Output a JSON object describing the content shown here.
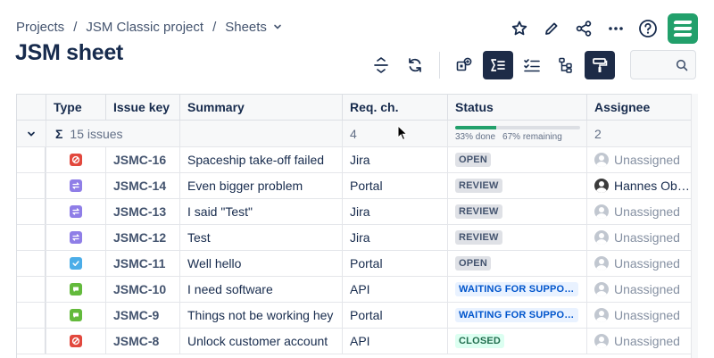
{
  "breadcrumb": {
    "items": [
      "Projects",
      "JSM Classic project",
      "Sheets"
    ],
    "separator": "/"
  },
  "page": {
    "title": "JSM sheet"
  },
  "search": {
    "placeholder": ""
  },
  "columns": [
    "Type",
    "Issue key",
    "Summary",
    "Req. ch.",
    "Status",
    "Assignee"
  ],
  "summary": {
    "sigma": "Σ",
    "issues": "15 issues",
    "req_count": "4",
    "progress_done": "33% done",
    "progress_remaining": "67% remaining",
    "progress_fraction": 0.33,
    "assignee_count": "2"
  },
  "rows": [
    {
      "type": "incident",
      "key": "JSMC-16",
      "summary": "Spaceship take-off failed",
      "req": "Jira",
      "status": "OPEN",
      "status_style": "grey",
      "assignee": "Unassigned",
      "avatar": "default"
    },
    {
      "type": "change",
      "key": "JSMC-14",
      "summary": "Even bigger problem",
      "req": "Portal",
      "status": "REVIEW",
      "status_style": "grey",
      "assignee": "Hannes Ob…",
      "avatar": "photo"
    },
    {
      "type": "change",
      "key": "JSMC-13",
      "summary": "I said \"Test\"",
      "req": "Jira",
      "status": "REVIEW",
      "status_style": "grey",
      "assignee": "Unassigned",
      "avatar": "default"
    },
    {
      "type": "change",
      "key": "JSMC-12",
      "summary": "Test",
      "req": "Jira",
      "status": "REVIEW",
      "status_style": "grey",
      "assignee": "Unassigned",
      "avatar": "default"
    },
    {
      "type": "task",
      "key": "JSMC-11",
      "summary": "Well hello",
      "req": "Portal",
      "status": "OPEN",
      "status_style": "grey",
      "assignee": "Unassigned",
      "avatar": "default"
    },
    {
      "type": "service-request",
      "key": "JSMC-10",
      "summary": "I need software",
      "req": "API",
      "status": "WAITING FOR SUPPORT",
      "status_style": "blue",
      "assignee": "Unassigned",
      "avatar": "default"
    },
    {
      "type": "service-request",
      "key": "JSMC-9",
      "summary": "Things not be working hey",
      "req": "Portal",
      "status": "WAITING FOR SUPPORT",
      "status_style": "blue",
      "assignee": "Unassigned",
      "avatar": "default"
    },
    {
      "type": "incident",
      "key": "JSMC-8",
      "summary": "Unlock customer account",
      "req": "API",
      "status": "CLOSED",
      "status_style": "green",
      "assignee": "Unassigned",
      "avatar": "default"
    }
  ],
  "colors": {
    "incident": "#e2483d",
    "change": "#8f7ee7",
    "task": "#4bade8",
    "service-request": "#63ba3c",
    "brand": "#22a06b",
    "toolbar_active": "#1d2b47"
  },
  "icons": {
    "top": [
      "star-icon",
      "edit-icon",
      "share-icon",
      "more-icon",
      "help-icon",
      "app-logo"
    ],
    "toolbar": [
      "collapse-rows-icon",
      "refresh-icon",
      "add-issue-icon",
      "sum-icon",
      "checklist-icon",
      "hierarchy-icon",
      "paint-format-icon",
      "search-icon"
    ]
  }
}
